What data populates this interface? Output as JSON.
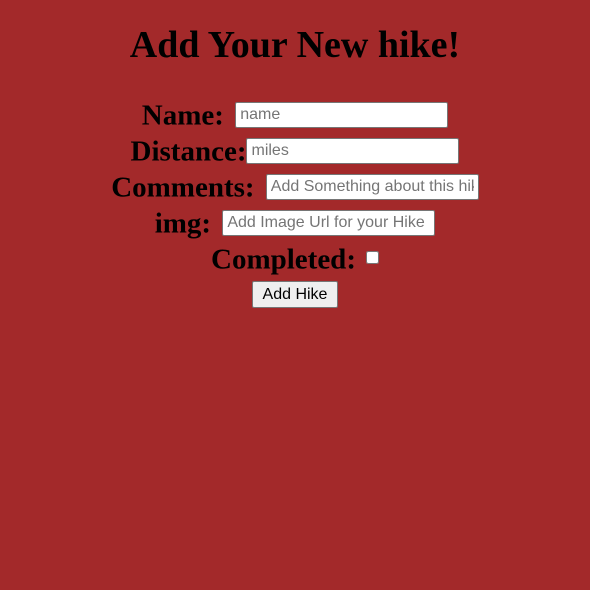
{
  "page": {
    "title": "Add Your New hike!"
  },
  "form": {
    "name": {
      "label": "Name:",
      "placeholder": "name",
      "value": ""
    },
    "distance": {
      "label": "Distance:",
      "placeholder": "miles",
      "value": ""
    },
    "comments": {
      "label": "Comments:",
      "placeholder": "Add Something about this hike",
      "value": ""
    },
    "img": {
      "label": "img:",
      "placeholder": "Add Image Url for your Hike",
      "value": ""
    },
    "completed": {
      "label": "Completed:",
      "checked": false
    },
    "submit_label": "Add Hike"
  },
  "colors": {
    "background": "#a3292a",
    "text": "#000000"
  }
}
